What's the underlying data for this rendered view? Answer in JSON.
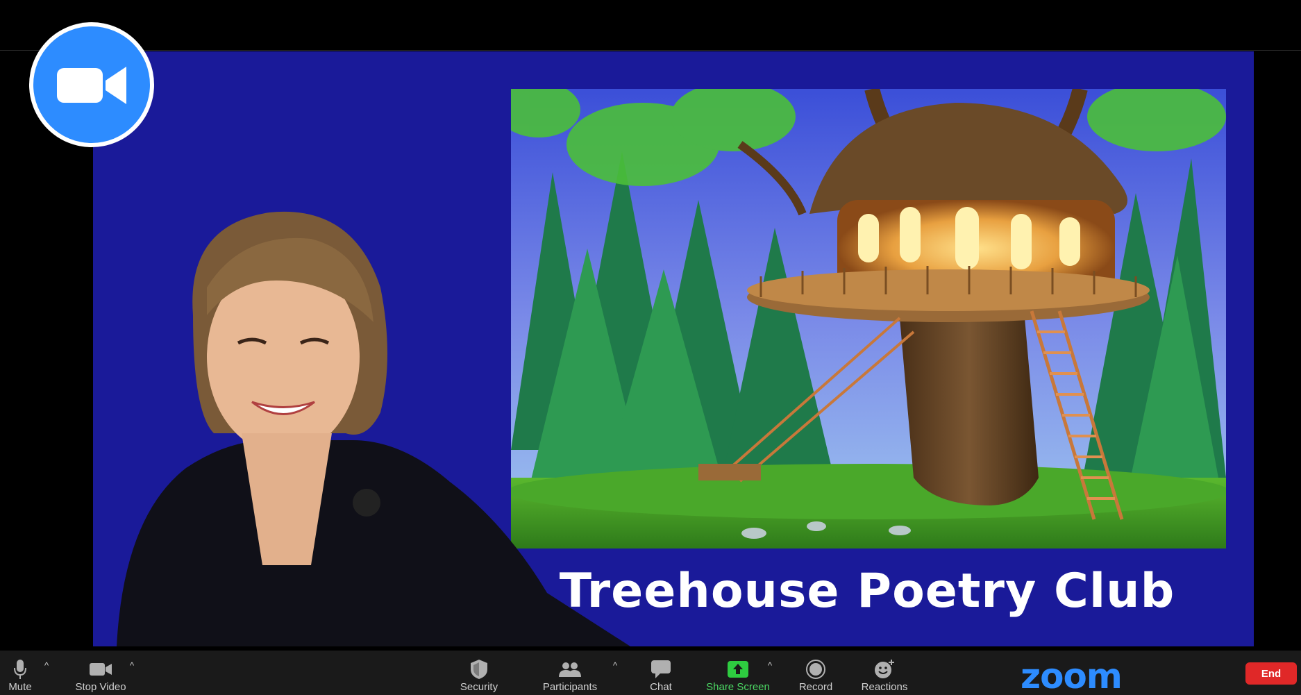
{
  "slide": {
    "title": "Treehouse Poetry Club"
  },
  "toolbar": {
    "mute_label": "Mute",
    "stop_video_label": "Stop Video",
    "security_label": "Security",
    "participants_label": "Participants",
    "chat_label": "Chat",
    "share_screen_label": "Share Screen",
    "record_label": "Record",
    "reactions_label": "Reactions",
    "end_label": "End",
    "caret": "^"
  },
  "brand": {
    "logo_text": "zoom",
    "accent_color": "#2d8cff",
    "end_color": "#e02828",
    "share_color": "#4cd964",
    "background_color": "#1a1a99"
  },
  "icons": {
    "app_badge": "video-camera-icon",
    "mute": "microphone-icon",
    "stop_video": "video-camera-icon",
    "security": "shield-icon",
    "participants": "people-icon",
    "chat": "chat-bubble-icon",
    "share_screen": "share-arrow-icon",
    "record": "record-icon",
    "reactions": "smiley-plus-icon"
  }
}
